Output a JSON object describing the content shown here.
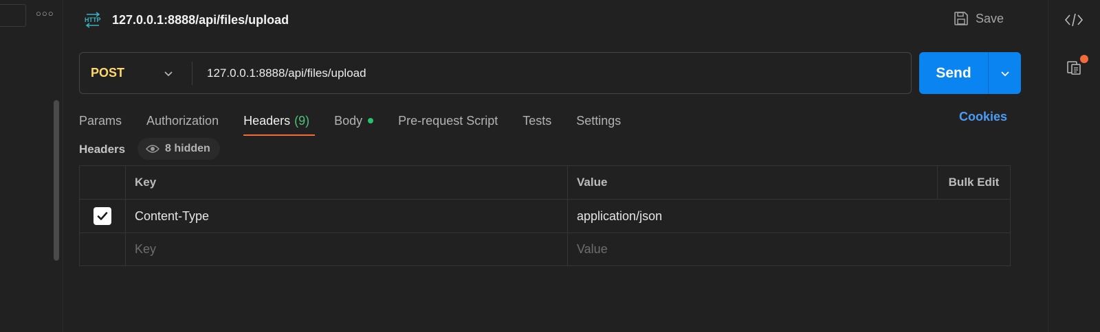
{
  "request": {
    "title": "127.0.0.1:8888/api/files/upload",
    "method": "POST",
    "url": "127.0.0.1:8888/api/files/upload",
    "save_label": "Save",
    "send_label": "Send"
  },
  "tabs": [
    {
      "label": "Params"
    },
    {
      "label": "Authorization"
    },
    {
      "label": "Headers",
      "count": "(9)"
    },
    {
      "label": "Body"
    },
    {
      "label": "Pre-request Script"
    },
    {
      "label": "Tests"
    },
    {
      "label": "Settings"
    }
  ],
  "cookies_label": "Cookies",
  "headers_section": {
    "label": "Headers",
    "hidden_label": "8 hidden"
  },
  "table": {
    "key_header": "Key",
    "value_header": "Value",
    "bulk_edit_label": "Bulk Edit",
    "rows": [
      {
        "key": "Content-Type",
        "value": "application/json"
      }
    ],
    "key_placeholder": "Key",
    "value_placeholder": "Value"
  },
  "icons": {
    "request": "http-icon",
    "save": "save-icon",
    "code": "code-icon",
    "docs": "documentation-icon"
  },
  "colors": {
    "method": "#ffd76b",
    "send": "#0a84f0",
    "active_tab_underline": "#f26b3a",
    "cookies": "#4c9cf5",
    "body_dot": "#27c26a"
  }
}
